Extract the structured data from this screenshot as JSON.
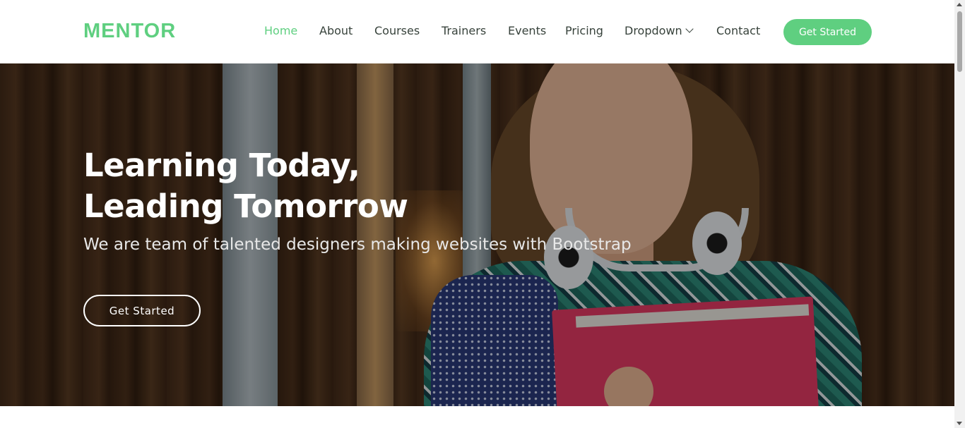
{
  "header": {
    "logo": "MENTOR",
    "nav": [
      {
        "label": "Home",
        "active": true
      },
      {
        "label": "About"
      },
      {
        "label": "Courses"
      },
      {
        "label": "Trainers"
      },
      {
        "label": "Events"
      },
      {
        "label": "Pricing"
      },
      {
        "label": "Dropdown",
        "has_dropdown": true
      },
      {
        "label": "Contact"
      }
    ],
    "cta_label": "Get Started"
  },
  "hero": {
    "title_line1": "Learning Today,",
    "title_line2": "Leading Tomorrow",
    "subtitle": "We are team of talented designers making websites with Bootstrap",
    "button_label": "Get Started"
  },
  "colors": {
    "accent": "#5fcf80",
    "nav_text": "#37423b"
  },
  "icons": {
    "dropdown": "chevron-down-icon"
  }
}
